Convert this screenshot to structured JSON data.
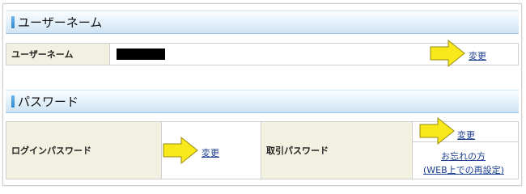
{
  "username_section": {
    "title": "ユーザーネーム",
    "label": "ユーザーネーム",
    "change_link": "変更"
  },
  "password_section": {
    "title": "パスワード",
    "login_label": "ログインパスワード",
    "login_change_link": "変更",
    "trade_label": "取引パスワード",
    "trade_change_link": "変更",
    "forgot_link": "お忘れの方",
    "forgot_sub_link": "(WEB上での再設定)"
  },
  "colors": {
    "header_gradient": [
      "#fbfdff",
      "#cfe4f4"
    ],
    "label_bg": "#f2f1e1",
    "link": "#1a3c8f",
    "arrow": "#f8e81c"
  },
  "icons": [
    "section-marker-icon",
    "arrow-pointer-icon"
  ]
}
